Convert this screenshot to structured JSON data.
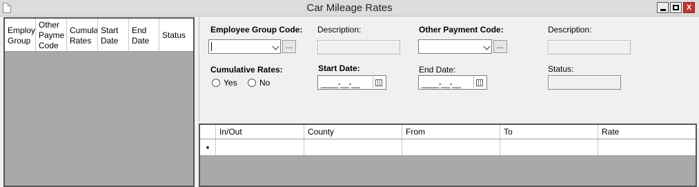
{
  "window": {
    "title": "Car Mileage Rates",
    "min_symbol": "",
    "max_symbol": "",
    "close_symbol": "X"
  },
  "left_list": {
    "columns": [
      "Employ\nGroup",
      "Other\nPayme\nCode",
      "Cumula\nRates",
      "Start\nDate",
      "End\nDate",
      "Status"
    ]
  },
  "form": {
    "employee_group_code_label": "Employee Group Code:",
    "description1_label": "Description:",
    "other_payment_code_label": "Other Payment Code:",
    "description2_label": "Description:",
    "cumulative_rates_label": "Cumulative Rates:",
    "yes_label": "Yes",
    "no_label": "No",
    "start_date_label": "Start Date:",
    "start_date_mask": "____-__-__",
    "end_date_label": "End Date:",
    "end_date_mask": "____-__-__",
    "status_label": "Status:",
    "lookup_button": "..."
  },
  "grid": {
    "columns": [
      "In/Out",
      "County",
      "From",
      "To",
      "Rate"
    ],
    "new_row_marker": "*"
  },
  "colors": {
    "panel_bg": "#f0f0f0",
    "empty_area": "#a9a9a9",
    "close_button": "#c9302c"
  }
}
